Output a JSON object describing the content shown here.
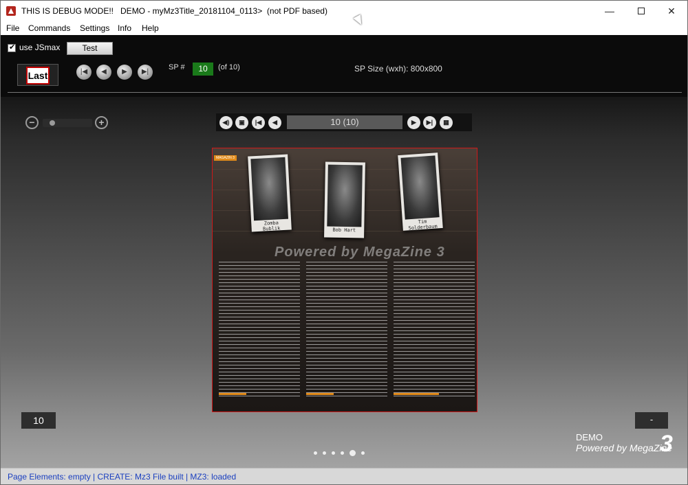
{
  "window": {
    "title": "THIS IS DEBUG MODE!!   DEMO - myMz3Title_20181104_0113>  (not PDF based)",
    "minimize": "—",
    "close": "✕"
  },
  "menu": [
    "File",
    "Commands",
    "Settings",
    "Info",
    "Help"
  ],
  "toolbar": {
    "use_jsmax_label": "use JSmax",
    "use_jsmax_checked": true,
    "test_button": "Test",
    "last_label": "Last",
    "sp_label": "SP #",
    "sp_value": "10",
    "sp_of": "(of 10)",
    "sp_size": "SP Size (wxh): 800x800"
  },
  "zoom": {
    "minus": "−",
    "plus": "+",
    "level": 0.1
  },
  "page_nav": {
    "field": "10 (10)"
  },
  "magazine": {
    "badge": "MAGAZIN 3",
    "photos": [
      "Zomba Bublik",
      "Bob Hart",
      "Tim Solderbaum"
    ],
    "watermark": "Powered by MegaZine 3"
  },
  "counters": {
    "left": "10",
    "right": "-"
  },
  "dots": {
    "count": 6,
    "active": 4
  },
  "branding": {
    "demo": "DEMO",
    "powered": "Powered by MegaZine",
    "three": "3"
  },
  "status": "Page Elements: empty | CREATE: Mz3 File built | MZ3: loaded"
}
